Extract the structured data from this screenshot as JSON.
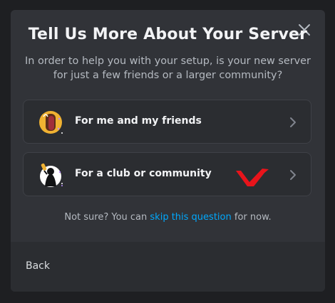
{
  "modal": {
    "title": "Tell Us More About Your Server",
    "subtitle": "In order to help you with your setup, is your new server for just a few friends or a larger community?",
    "close_icon": "close-icon"
  },
  "options": [
    {
      "label": "For me and my friends",
      "icon": "friends-illustration-icon",
      "chevron": "chevron-right-icon"
    },
    {
      "label": "For a club or community",
      "icon": "community-illustration-icon",
      "chevron": "chevron-right-icon"
    }
  ],
  "not_sure": {
    "prefix": "Not sure? You can ",
    "link": "skip this question",
    "suffix": " for now."
  },
  "footer": {
    "back_label": "Back"
  },
  "colors": {
    "modal_bg": "#313338",
    "footer_bg": "#2b2d31",
    "link": "#00a8fc",
    "annotation": "#e8141b"
  }
}
